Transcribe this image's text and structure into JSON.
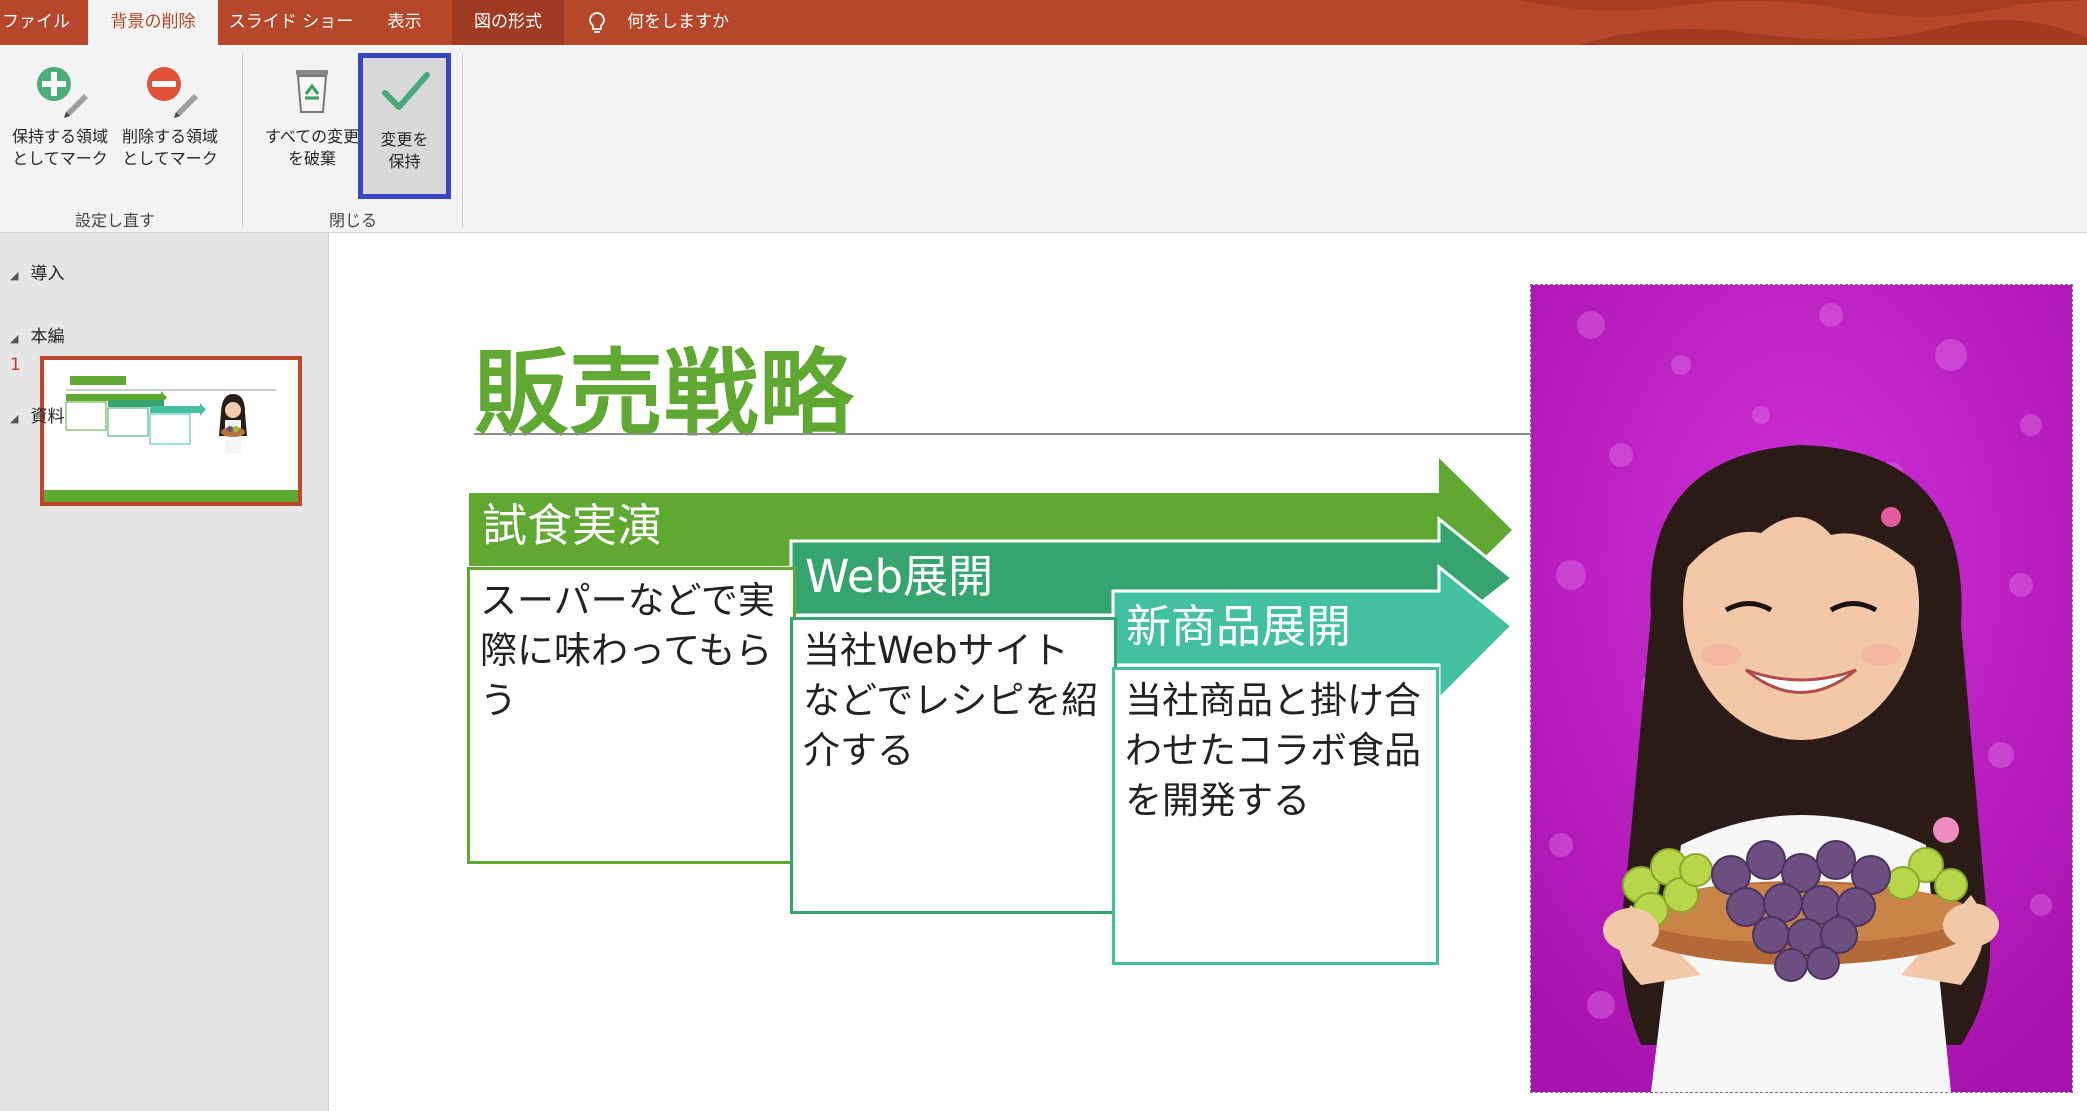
{
  "tabs": [
    {
      "label": "ファイル"
    },
    {
      "label": "背景の削除"
    },
    {
      "label": "スライド ショー"
    },
    {
      "label": "表示"
    },
    {
      "label": "図の形式"
    }
  ],
  "tell_me": {
    "label": "何をしますか"
  },
  "ribbon": {
    "mark_keep": {
      "line1": "保持する領域",
      "line2": "としてマーク"
    },
    "mark_remove": {
      "line1": "削除する領域",
      "line2": "としてマーク"
    },
    "discard": {
      "line1": "すべての変更",
      "line2": "を破棄"
    },
    "keep_changes": {
      "line1": "変更を",
      "line2": "保持"
    },
    "group_refine": "設定し直す",
    "group_close": "閉じる"
  },
  "sections": [
    {
      "label": "導入"
    },
    {
      "label": "本編"
    },
    {
      "label": "資料"
    }
  ],
  "slide_number": "1",
  "slide": {
    "title": "販売戦略",
    "steps": [
      {
        "label": "試食実演",
        "text": "スーパーなどで実際に味わってもらう"
      },
      {
        "label": "Web展開",
        "text": "当社Webサイトなどでレシピを紹介する"
      },
      {
        "label": "新商品展開",
        "text": "当社商品と掛け合わせたコラボ食品を開発する"
      }
    ]
  },
  "colors": {
    "accent_tab": "#b7472a",
    "title_green": "#5fa832",
    "step1": "#5fa832",
    "step2": "#36a46e",
    "step3": "#42c0a0",
    "removal_magenta": "#c020c8",
    "highlight": "#3a46c4"
  },
  "icons": {
    "mark_keep": "plus-pencil-icon",
    "mark_remove": "minus-pencil-icon",
    "discard": "recycle-bin-icon",
    "keep_changes": "checkmark-icon",
    "tell_me": "lightbulb-icon"
  }
}
